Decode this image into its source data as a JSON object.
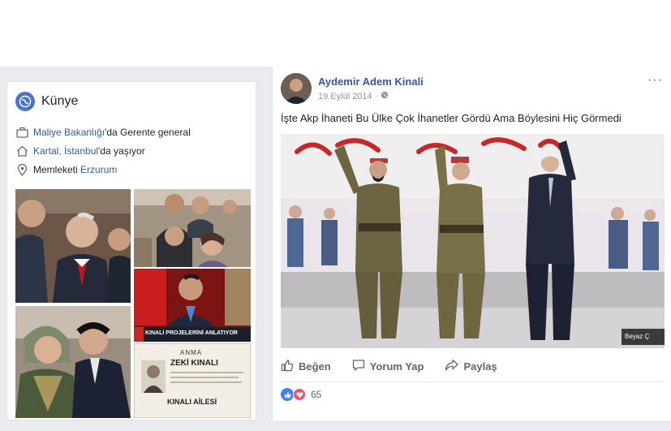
{
  "about_card": {
    "title": "Künye",
    "work": {
      "link": "Maliye Bakanlığı",
      "suffix": "'da Gerente general"
    },
    "lives": {
      "link": "Kartal, İstanbul",
      "suffix": "'da yaşıyor"
    },
    "hometown": {
      "prefix": "Memleketi ",
      "link": "Erzurum"
    },
    "photos": [
      {
        "icon": "photo-officials"
      },
      {
        "icon": "photo-group-selfie"
      },
      {
        "icon": "photo-tv-studio",
        "caption": "KINALI PROJELERİNİ ANLATIYOR"
      },
      {
        "icon": "photo-mother-son"
      },
      {
        "icon": "photo-obituary",
        "lines": [
          "ANMA",
          "ZEKİ KINALI",
          "KINALI AİLESİ"
        ]
      }
    ]
  },
  "post": {
    "author": "Aydemir Adem Kinali",
    "date": "19 Eylül 2014 ·",
    "privacy_icon": "globe-icon",
    "more": "···",
    "text": "İşte Akp İhaneti Bu Ülke Çok İhanetler Gördü Ama Böylesini Hiç Görmedi",
    "image_sign": "Beyaz Ç",
    "actions": [
      {
        "label": "Beğen",
        "icon": "thumbs-up-icon"
      },
      {
        "label": "Yorum Yap",
        "icon": "comment-icon"
      },
      {
        "label": "Paylaş",
        "icon": "share-icon"
      }
    ],
    "reaction_count": "65"
  },
  "colors": {
    "link": "#365899",
    "bg": "#e9ebee",
    "like": "#4080ff",
    "love": "#f25268"
  }
}
